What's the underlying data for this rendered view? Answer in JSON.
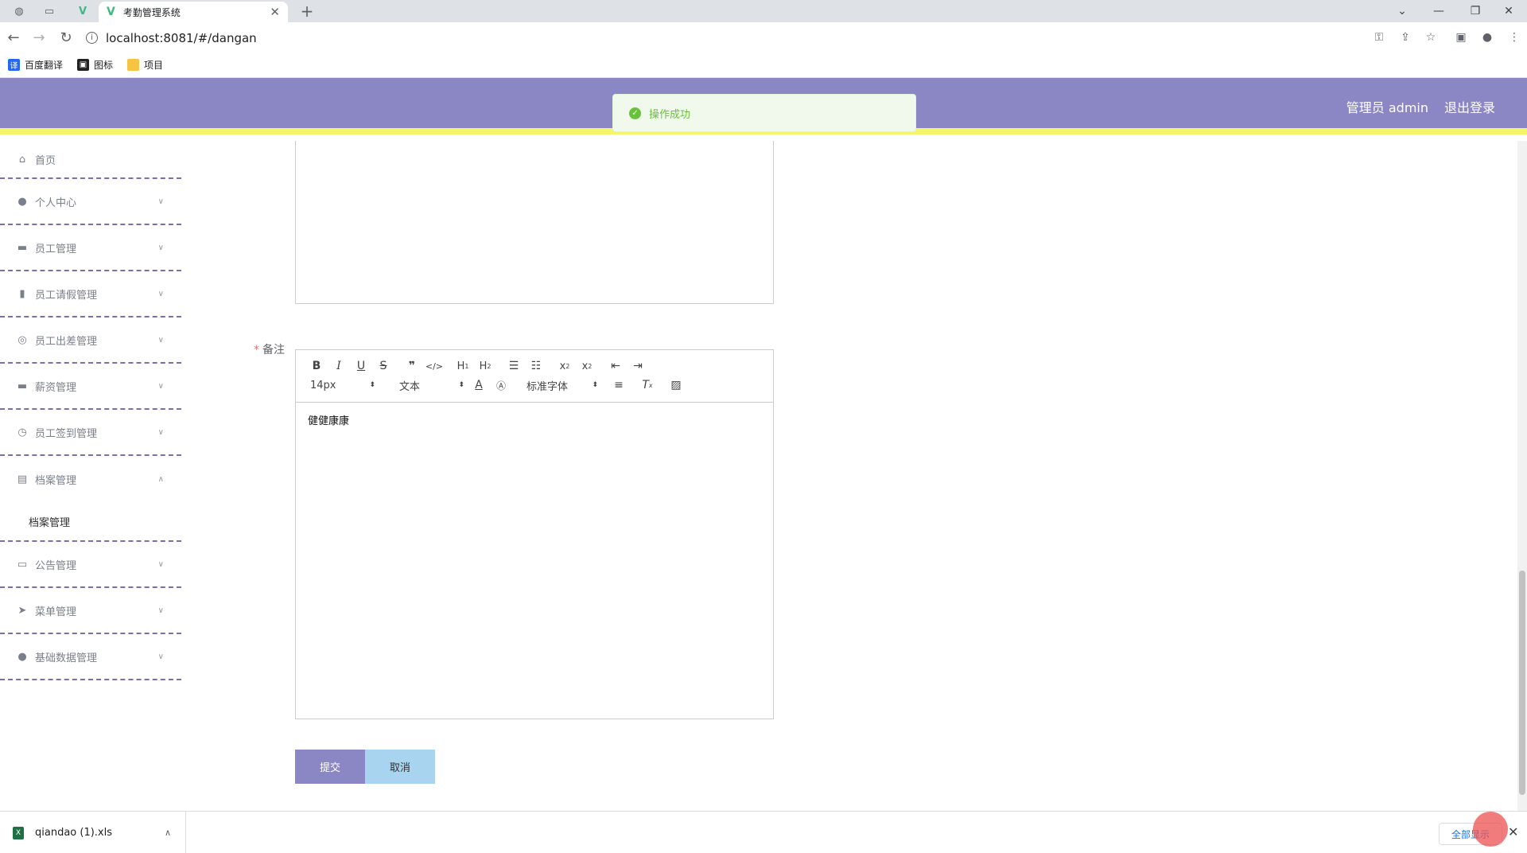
{
  "browser": {
    "tab_title": "考勤管理系统",
    "url": "localhost:8081/#/dangan",
    "bookmarks": [
      {
        "label": "百度翻译",
        "icon": "translate-icon",
        "color": "#2468f2"
      },
      {
        "label": "图标",
        "icon": "image-icon",
        "color": "#222222"
      },
      {
        "label": "项目",
        "icon": "folder-icon",
        "color": "#f6c343"
      }
    ]
  },
  "header": {
    "user": "管理员 admin",
    "logout": "退出登录",
    "bg_color": "#8b87c4",
    "accent_color": "#f5f56a"
  },
  "toast": {
    "message": "操作成功",
    "type": "success"
  },
  "sidebar": {
    "items": [
      {
        "label": "首页",
        "icon": "home-icon"
      },
      {
        "label": "个人中心",
        "icon": "user-icon"
      },
      {
        "label": "员工管理",
        "icon": "briefcase-icon"
      },
      {
        "label": "员工请假管理",
        "icon": "bar-chart-icon"
      },
      {
        "label": "员工出差管理",
        "icon": "globe-icon"
      },
      {
        "label": "薪资管理",
        "icon": "wallet-icon"
      },
      {
        "label": "员工签到管理",
        "icon": "clock-icon"
      },
      {
        "label": "档案管理",
        "icon": "clipboard-icon",
        "expanded": true,
        "children": [
          "档案管理"
        ]
      },
      {
        "label": "公告管理",
        "icon": "monitor-icon"
      },
      {
        "label": "菜单管理",
        "icon": "send-icon"
      },
      {
        "label": "基础数据管理",
        "icon": "user-icon"
      }
    ]
  },
  "form": {
    "remark_label": "备注",
    "editor": {
      "font_size": "14px",
      "header_select": "文本",
      "font_family": "标准字体",
      "content": "健健康康"
    },
    "submit": "提交",
    "cancel": "取消"
  },
  "downloads": {
    "file": "qiandao (1).xls",
    "show_all": "全部显示"
  }
}
